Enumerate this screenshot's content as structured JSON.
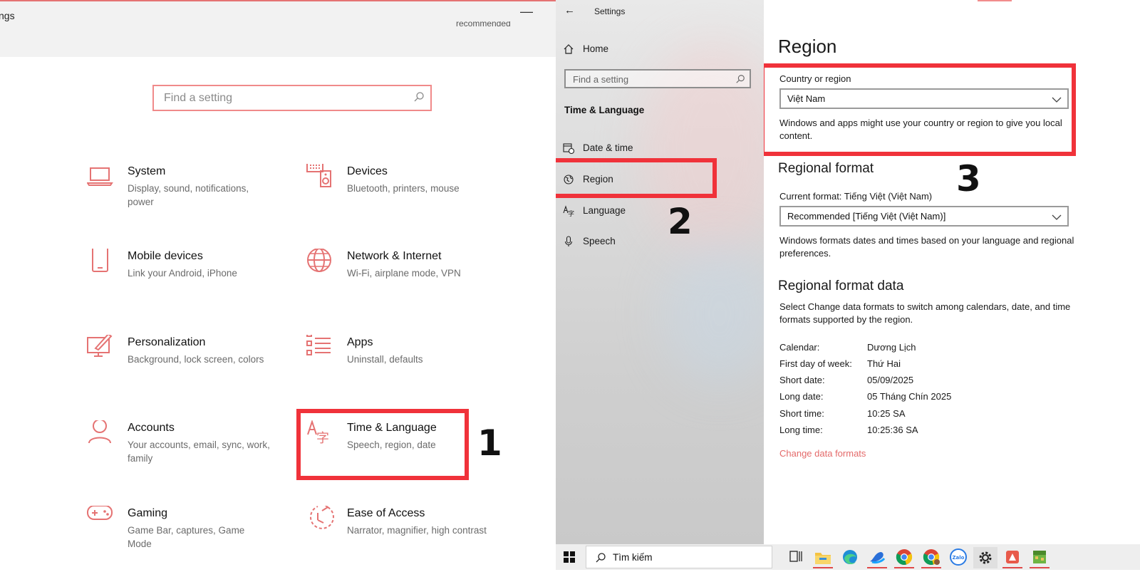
{
  "left": {
    "title": "ngs",
    "minimize": "—",
    "recommended": "recommended",
    "search_placeholder": "Find a setting",
    "tiles": [
      {
        "title": "System",
        "desc": "Display, sound, notifications, power"
      },
      {
        "title": "Devices",
        "desc": "Bluetooth, printers, mouse"
      },
      {
        "title": "Mobile devices",
        "desc": "Link your Android, iPhone"
      },
      {
        "title": "Network & Internet",
        "desc": "Wi-Fi, airplane mode, VPN"
      },
      {
        "title": "Personalization",
        "desc": "Background, lock screen, colors"
      },
      {
        "title": "Apps",
        "desc": "Uninstall, defaults"
      },
      {
        "title": "Accounts",
        "desc": "Your accounts, email, sync, work, family"
      },
      {
        "title": "Time & Language",
        "desc": "Speech, region, date"
      },
      {
        "title": "Gaming",
        "desc": "Game Bar, captures, Game Mode"
      },
      {
        "title": "Ease of Access",
        "desc": "Narrator, magnifier, high contrast"
      }
    ]
  },
  "steps": [
    "1",
    "2",
    "3"
  ],
  "mid": {
    "back": "←",
    "title": "Settings",
    "home": "Home",
    "search_placeholder": "Find a setting",
    "section": "Time & Language",
    "items": [
      "Date & time",
      "Region",
      "Language",
      "Speech"
    ]
  },
  "right": {
    "heading": "Region",
    "country_label": "Country or region",
    "country_value": "Việt Nam",
    "country_note": "Windows and apps might use your country or region to give you local content.",
    "format_heading": "Regional format",
    "current_format": "Current format: Tiếng Việt (Việt Nam)",
    "format_value": "Recommended [Tiếng Việt (Việt Nam)]",
    "format_note": "Windows formats dates and times based on your language and regional preferences.",
    "data_heading": "Regional format data",
    "data_note": "Select Change data formats to switch among calendars, date, and time formats supported by the region.",
    "data_rows": [
      {
        "k": "Calendar:",
        "v": "Dương Lịch"
      },
      {
        "k": "First day of week:",
        "v": "Thứ Hai"
      },
      {
        "k": "Short date:",
        "v": "05/09/2025"
      },
      {
        "k": "Long date:",
        "v": "05 Tháng Chín 2025"
      },
      {
        "k": "Short time:",
        "v": "10:25 SA"
      },
      {
        "k": "Long time:",
        "v": "10:25:36 SA"
      }
    ],
    "change_link": "Change data formats"
  },
  "taskbar": {
    "search_label": "Tìm kiếm",
    "apps": [
      "task-view",
      "file-explorer",
      "edge",
      "copilot",
      "chrome",
      "chrome-profile",
      "zalo",
      "settings",
      "app-red",
      "app-minecraft"
    ]
  },
  "colors": {
    "accent": "#e57373",
    "highlight": "#f0323a",
    "link": "#e46a6a"
  }
}
